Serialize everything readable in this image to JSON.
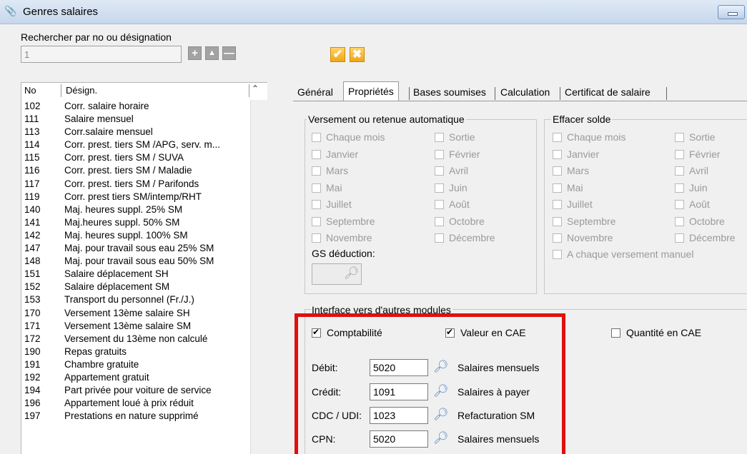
{
  "window": {
    "title": "Genres salaires"
  },
  "search": {
    "label": "Rechercher par no ou désignation",
    "value": "1"
  },
  "toolbar": {
    "add_icon": "plus-icon",
    "up_icon": "triangle-up-icon",
    "remove_icon": "minus-icon",
    "confirm_icon": "checkmark-icon",
    "cancel_icon": "x-icon",
    "accent": "#f0a515"
  },
  "list": {
    "col_no": "No",
    "col_designation": "Désign.",
    "rows": [
      {
        "no": "102",
        "designation": "Corr. salaire horaire"
      },
      {
        "no": "111",
        "designation": "Salaire mensuel"
      },
      {
        "no": "113",
        "designation": "Corr.salaire mensuel"
      },
      {
        "no": "114",
        "designation": "Corr. prest. tiers SM /APG, serv. m..."
      },
      {
        "no": "115",
        "designation": "Corr. prest. tiers SM / SUVA"
      },
      {
        "no": "116",
        "designation": "Corr. prest. tiers SM / Maladie"
      },
      {
        "no": "117",
        "designation": "Corr. prest. tiers SM / Parifonds"
      },
      {
        "no": "119",
        "designation": "Corr. prest tiers SM/intemp/RHT"
      },
      {
        "no": "140",
        "designation": "Maj. heures suppl. 25% SM"
      },
      {
        "no": "141",
        "designation": "Maj.heures suppl.  50% SM"
      },
      {
        "no": "142",
        "designation": "Maj. heures suppl. 100% SM"
      },
      {
        "no": "147",
        "designation": "Maj. pour travail sous eau 25% SM"
      },
      {
        "no": "148",
        "designation": "Maj. pour travail sous eau 50% SM"
      },
      {
        "no": "151",
        "designation": "Salaire déplacement SH"
      },
      {
        "no": "152",
        "designation": "Salaire déplacement SM"
      },
      {
        "no": "153",
        "designation": "Transport du personnel (Fr./J.)"
      },
      {
        "no": "170",
        "designation": "Versement 13ème salaire SH"
      },
      {
        "no": "171",
        "designation": "Versement 13ème salaire SM"
      },
      {
        "no": "172",
        "designation": "Versement du 13ème non calculé"
      },
      {
        "no": "190",
        "designation": "Repas gratuits"
      },
      {
        "no": "191",
        "designation": "Chambre gratuite"
      },
      {
        "no": "192",
        "designation": "Appartement gratuit"
      },
      {
        "no": "194",
        "designation": "Part privée pour voiture de service"
      },
      {
        "no": "196",
        "designation": "Appartement loué à prix réduit"
      },
      {
        "no": "197",
        "designation": "Prestations en nature supprimé"
      }
    ]
  },
  "tabs": [
    {
      "label": "Général"
    },
    {
      "label": "Propriétés"
    },
    {
      "label": "Bases soumises"
    },
    {
      "label": "Calculation"
    },
    {
      "label": "Certificat de salaire"
    }
  ],
  "versement": {
    "title": "Versement ou retenue automatique",
    "items": [
      "Chaque mois",
      "Sortie",
      "Janvier",
      "Février",
      "Mars",
      "Avril",
      "Mai",
      "Juin",
      "Juillet",
      "Août",
      "Septembre",
      "Octobre",
      "Novembre",
      "Décembre"
    ],
    "gs_label": "GS déduction:"
  },
  "effacer": {
    "title": "Effacer solde",
    "items": [
      "Chaque mois",
      "Sortie",
      "Janvier",
      "Février",
      "Mars",
      "Avril",
      "Mai",
      "Juin",
      "Juillet",
      "Août",
      "Septembre",
      "Octobre",
      "Novembre",
      "Décembre"
    ],
    "manual": "A chaque versement manuel"
  },
  "interface": {
    "title": "Interface vers d'autres modules",
    "comptabilite": "Comptabilité",
    "valeur_cae": "Valeur en CAE",
    "quantite_cae": "Quantité en CAE",
    "highlight": "#e01010",
    "accounts": [
      {
        "label": "Débit:",
        "value": "5020",
        "desc": "Salaires mensuels"
      },
      {
        "label": "Crédit:",
        "value": "1091",
        "desc": "Salaires à payer"
      },
      {
        "label": "CDC / UDI:",
        "value": "1023",
        "desc": "Refacturation SM"
      },
      {
        "label": "CPN:",
        "value": "5020",
        "desc": "Salaires mensuels"
      }
    ]
  }
}
